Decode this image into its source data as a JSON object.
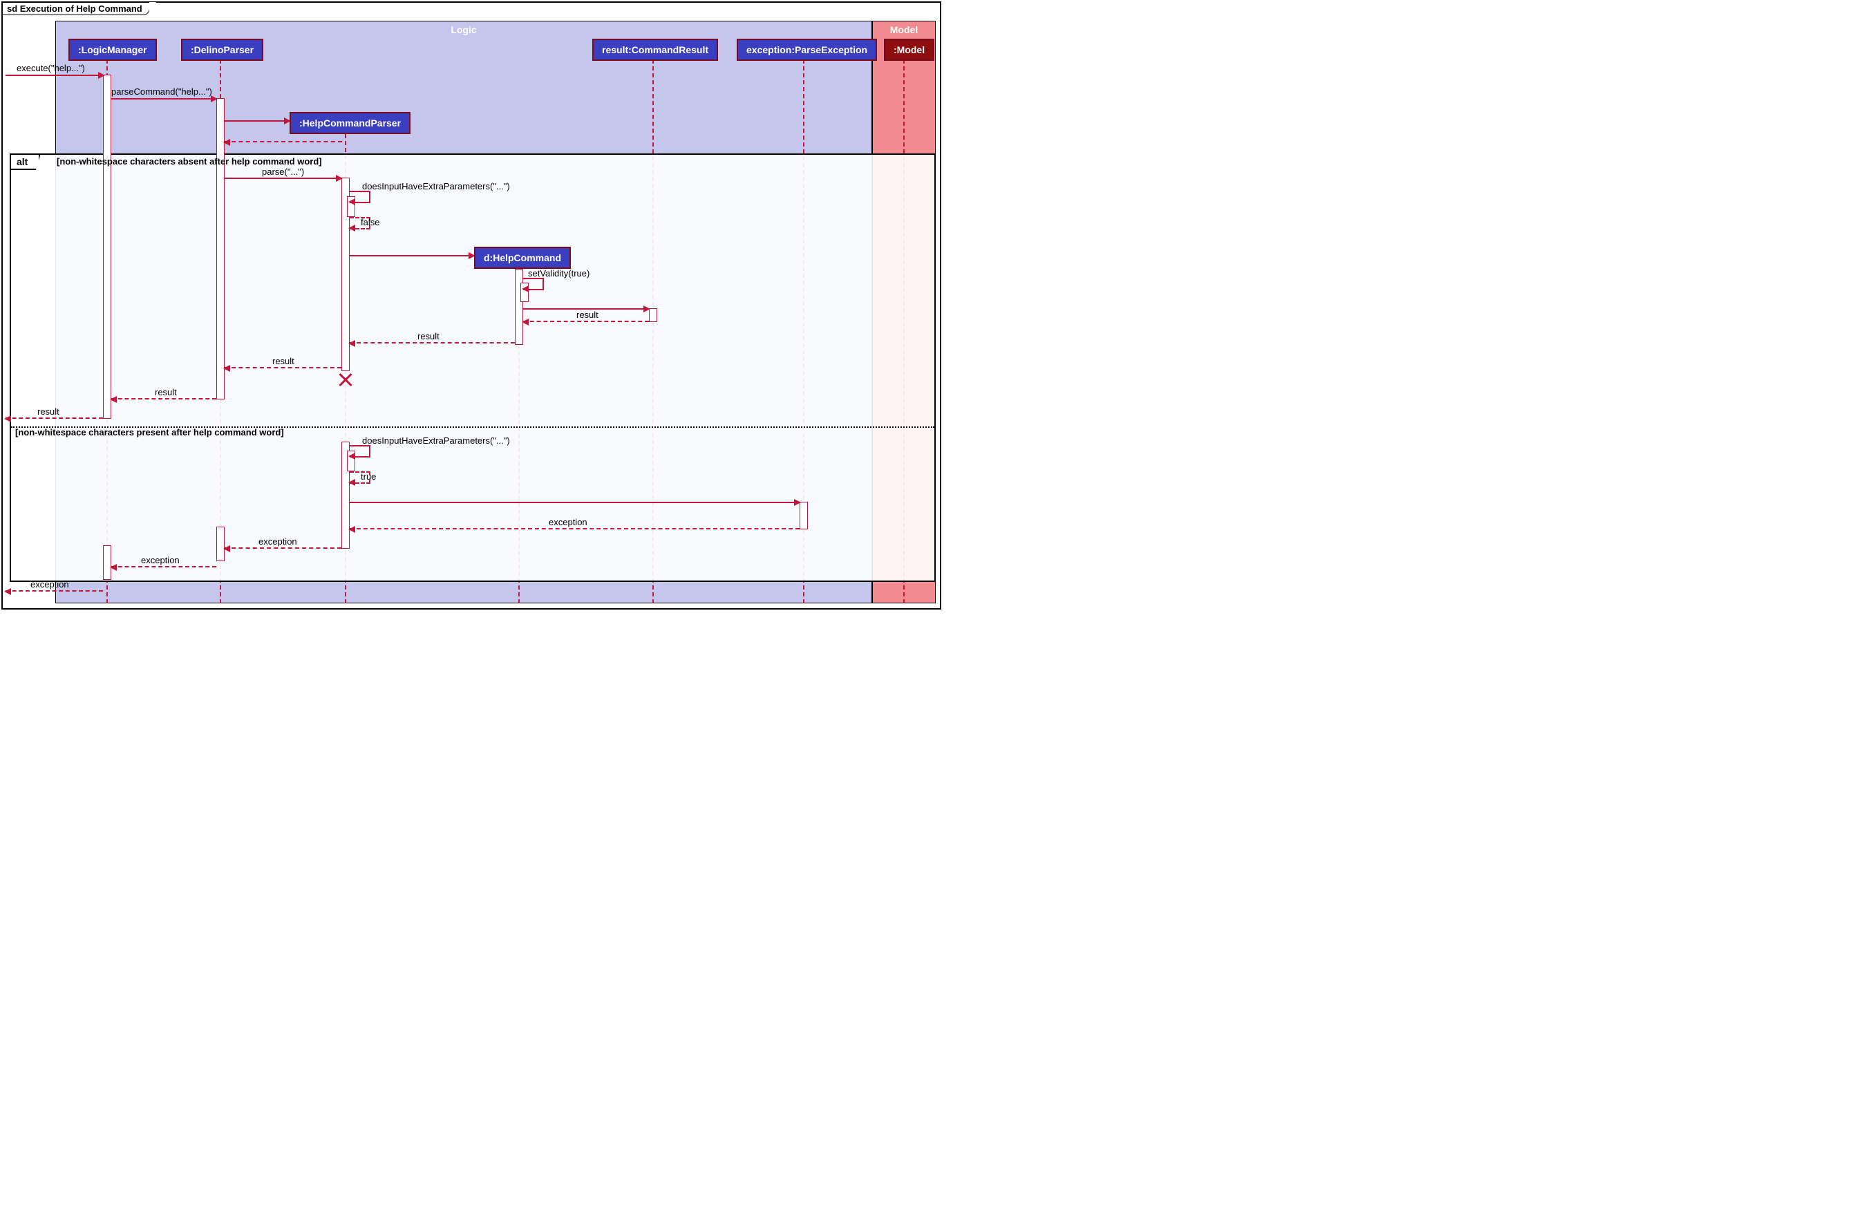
{
  "diagram": {
    "title": "sd Execution of Help Command",
    "regions": {
      "logic": "Logic",
      "model": "Model"
    },
    "participants": {
      "logicManager": ":LogicManager",
      "delinoParser": ":DelinoParser",
      "helpCommandParser": ":HelpCommandParser",
      "helpCommand": "d:HelpCommand",
      "commandResult": "result:CommandResult",
      "parseException": "exception:ParseException",
      "model": ":Model"
    },
    "messages": {
      "execute": "execute(\"help...\")",
      "parseCommand": "parseCommand(\"help...\")",
      "parse": "parse(\"...\")",
      "doesInputExtra1": "doesInputHaveExtraParameters(\"...\")",
      "falseLbl": "false",
      "setValidity": "setValidity(true)",
      "result": "result",
      "doesInputExtra2": "doesInputHaveExtraParameters(\"...\")",
      "trueLbl": "true",
      "exception": "exception"
    },
    "frame": {
      "operator": "alt",
      "guard1": "[non-whitespace characters absent after help command word]",
      "guard2": "[non-whitespace characters present after help command word]"
    }
  }
}
